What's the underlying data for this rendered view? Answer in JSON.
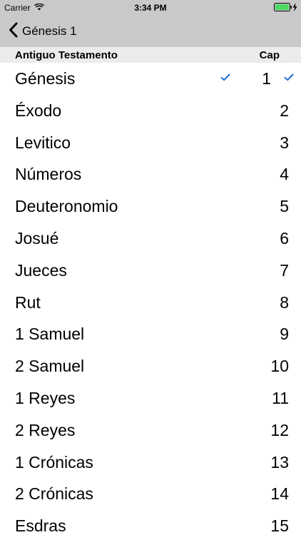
{
  "status": {
    "carrier": "Carrier",
    "time": "3:34 PM",
    "battery_color": "#4cd964"
  },
  "nav": {
    "back_label": "Génesis 1",
    "back_icon": "chevron-left-icon"
  },
  "header": {
    "left": "Antiguo Testamento",
    "right": "Cap"
  },
  "accent": "#1a6fd8",
  "books": [
    {
      "name": "Génesis",
      "chapter": "1",
      "selected": true
    },
    {
      "name": "Éxodo",
      "chapter": "2"
    },
    {
      "name": "Levitico",
      "chapter": "3"
    },
    {
      "name": "Números",
      "chapter": "4"
    },
    {
      "name": "Deuteronomio",
      "chapter": "5"
    },
    {
      "name": "Josué",
      "chapter": "6"
    },
    {
      "name": "Jueces",
      "chapter": "7"
    },
    {
      "name": "Rut",
      "chapter": "8"
    },
    {
      "name": "1 Samuel",
      "chapter": "9"
    },
    {
      "name": "2 Samuel",
      "chapter": "10"
    },
    {
      "name": "1 Reyes",
      "chapter": "11"
    },
    {
      "name": "2 Reyes",
      "chapter": "12"
    },
    {
      "name": "1 Crónicas",
      "chapter": "13"
    },
    {
      "name": "2 Crónicas",
      "chapter": "14"
    },
    {
      "name": "Esdras",
      "chapter": "15"
    }
  ]
}
